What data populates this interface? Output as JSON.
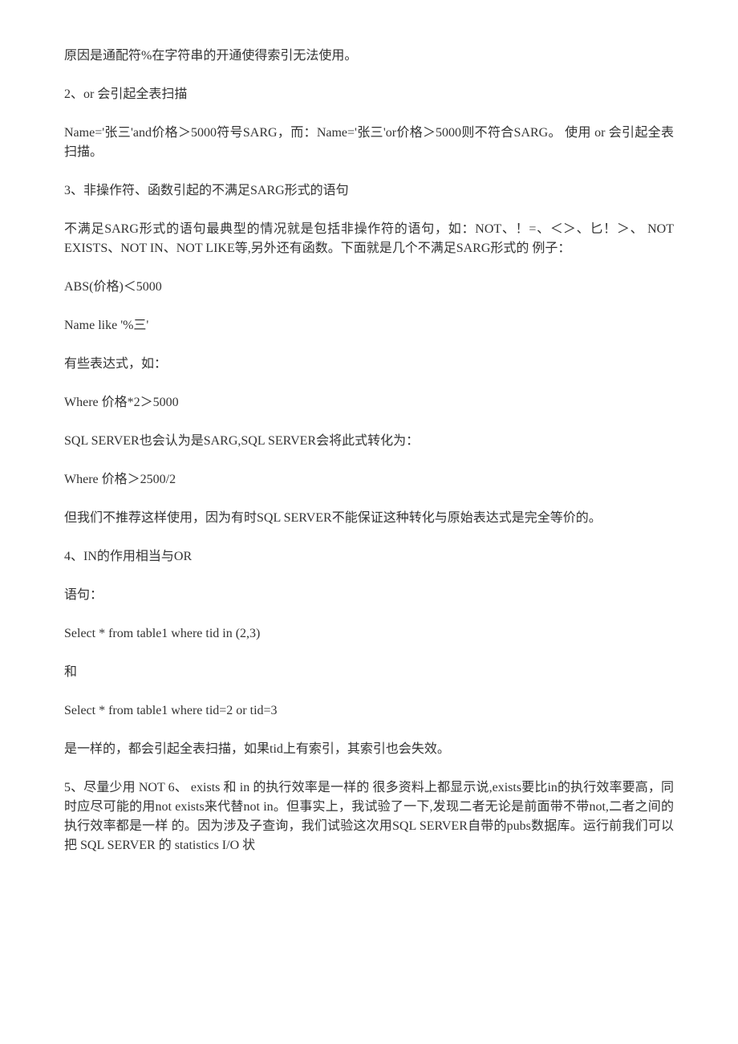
{
  "paragraphs": [
    "原因是通配符%在字符串的开通使得索引无法使用。",
    "2、or 会引起全表扫描",
    "Name='张三'and价格＞5000符号SARG，而：Name='张三'or价格＞5000则不符合SARG。  使用  or 会引起全表扫描。",
    "3、非操作符、函数引起的不满足SARG形式的语句",
    "不满足SARG形式的语句最典型的情况就是包括非操作符的语句，如：NOT、！=、＜＞、匕！＞、  NOT EXISTS、NOT IN、NOT LIKE等,另外还有函数。下面就是几个不满足SARG形式的  例子：",
    "ABS(价格)＜5000",
    "Name like '%三'",
    "有些表达式，如：",
    "Where 价格*2＞5000",
    "SQL SERVER也会认为是SARG,SQL SERVER会将此式转化为：",
    "Where 价格＞2500/2",
    "但我们不推荐这样使用，因为有时SQL SERVER不能保证这种转化与原始表达式是完全等价的。",
    "4、IN的作用相当与OR",
    "语句：",
    "Select * from table1 where tid in (2,3)",
    "和",
    "Select * from table1 where tid=2 or tid=3",
    "是一样的，都会引起全表扫描，如果tid上有索引，其索引也会失效。",
    "5、尽量少用 NOT 6、 exists 和 in 的执行效率是一样的 很多资料上都显示说,exists要比in的执行效率要高，同时应尽可能的用not exists来代替not in。但事实上，我试验了一下,发现二者无论是前面带不带not,二者之间的执行效率都是一样 的。因为涉及子查询，我们试验这次用SQL SERVER自带的pubs数据库。运行前我们可以  把 SQL SERVER 的  statistics I/O 状"
  ]
}
